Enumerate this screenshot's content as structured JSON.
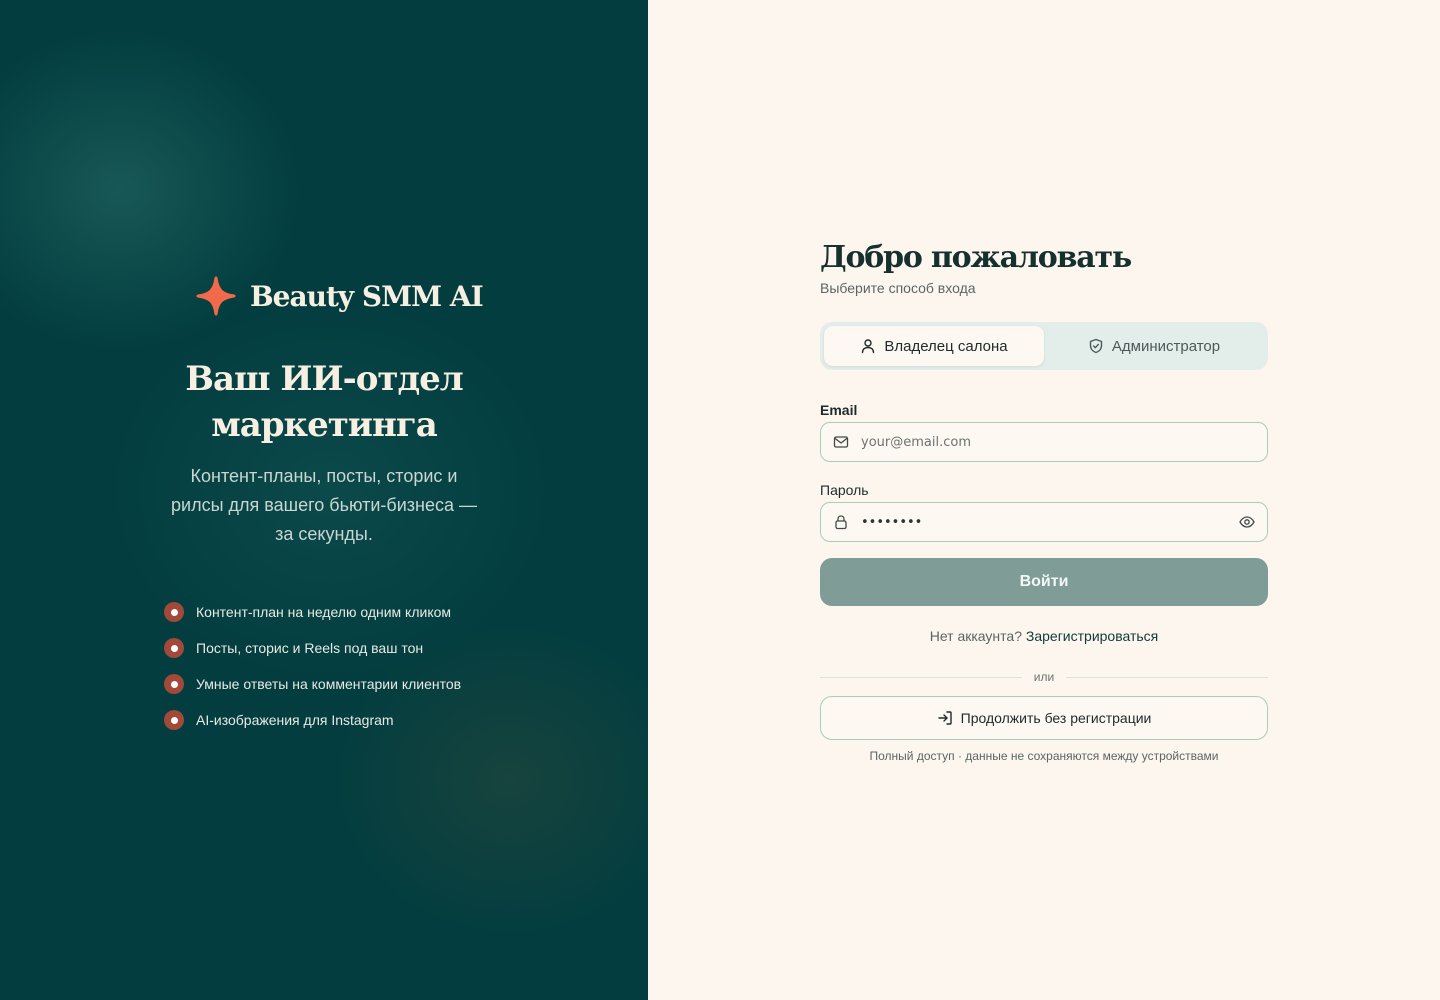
{
  "brand": {
    "name": "Beauty SMM AI",
    "star_color": "#f26a4b"
  },
  "hero": {
    "headline_line1": "Ваш ИИ-отдел",
    "headline_line2": "маркетинга",
    "subline": "Контент-планы, посты, сторис и рилсы для вашего бьюти-бизнеса — за секунды.",
    "features": [
      "Контент-план на неделю одним кликом",
      "Посты, сторис и Reels под ваш тон",
      "Умные ответы на комментарии клиентов",
      "AI-изображения для Instagram"
    ]
  },
  "login": {
    "title": "Добро пожаловать",
    "subtitle": "Выберите способ входа",
    "roles": [
      {
        "label": "Владелец салона",
        "icon": "user-icon",
        "active": true
      },
      {
        "label": "Администратор",
        "icon": "shield-icon",
        "active": false
      }
    ],
    "email": {
      "label": "Email",
      "placeholder": "your@email.com",
      "icon": "mail-icon"
    },
    "password": {
      "label": "Пароль",
      "value": "••••••••",
      "icon": "lock-icon",
      "toggle_icon": "eye-icon"
    },
    "submit_label": "Войти",
    "no_account_text": "Нет аккаунта?",
    "register_link": "Зарегистрироваться",
    "divider_text": "или",
    "guest_label": "Продолжить без регистрации",
    "guest_icon": "login-arrow-icon",
    "guest_note": "Полный доступ · данные не сохраняются между устройствами"
  },
  "colors": {
    "left_bg": "#033d3f",
    "right_bg": "#fdf6ee",
    "submit_bg": "#7f9c97",
    "bullet": "#a24a3a",
    "accent_star": "#f26a4b"
  }
}
